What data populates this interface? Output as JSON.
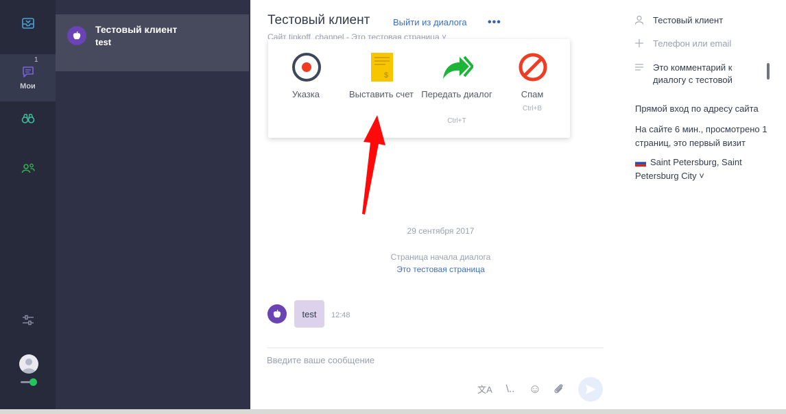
{
  "rail": {
    "items": [
      {
        "id": "inbox",
        "label": ""
      },
      {
        "id": "mine",
        "label": "Мои",
        "badge": "1"
      },
      {
        "id": "watch",
        "label": ""
      },
      {
        "id": "team",
        "label": ""
      }
    ]
  },
  "dialog_list": {
    "item": {
      "name": "Тестовый клиент",
      "preview": "test"
    }
  },
  "chat": {
    "title": "Тестовый клиент",
    "exit_label": "Выйти из диалога",
    "more_label": "•••",
    "subtitle": "Сайт tinkoff_channel - Это тестовая страница ˅",
    "popup": {
      "items": [
        {
          "label": "Указка",
          "hotkey": ""
        },
        {
          "label": "Выставить счет",
          "hotkey": ""
        },
        {
          "label": "Передать диалог",
          "hotkey": "Ctrl+T"
        },
        {
          "label": "Спам",
          "hotkey": "Ctrl+B"
        }
      ]
    },
    "date_separator": "29 сентября 2017",
    "start_note": "Страница начала диалога",
    "start_link": "Это тестовая страница",
    "message": {
      "text": "test",
      "time": "12:48"
    },
    "input_placeholder": "Введите ваше сообщение",
    "tools": {
      "translate": "文A",
      "templates": "\\..",
      "emoji": "☺",
      "attach": "📎"
    }
  },
  "right_panel": {
    "client_name": "Тестовый клиент",
    "contact_placeholder": "Телефон или email",
    "comment": "Это комментарий к диалогу с тестовой",
    "entry": "Прямой вход по адресу сайта",
    "visit": "На сайте 6 мин., просмотрено 1 страниц, это первый визит",
    "location": "Saint Petersburg, Saint Petersburg City ˅"
  },
  "colors": {
    "rail_bg": "#272a3b",
    "list_bg": "#2f3246",
    "selected_bg": "#474a5d",
    "accent_link": "#3a6fc7",
    "avatar_purple": "#6a43b5",
    "bubble": "#dcd2ec",
    "annotation_arrow": "#ff0000"
  }
}
